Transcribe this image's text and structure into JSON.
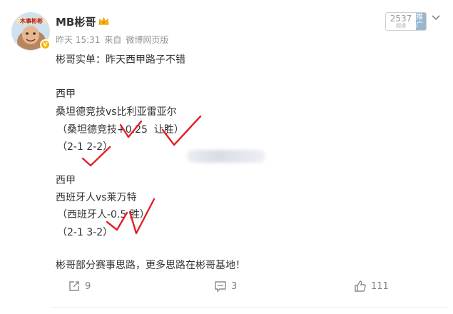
{
  "author": {
    "avatar_text": "木事彬彬",
    "name": "MB彬哥",
    "badge_icon": "crown-icon",
    "verified_icon": "verified-badge-icon"
  },
  "meta": {
    "time": "昨天 15:31",
    "source_prefix": "来自",
    "source": "微博网页版"
  },
  "promo": {
    "count": "2537",
    "count_label": "阅读",
    "boost_label": "推广"
  },
  "post": {
    "lines": [
      "彬哥实单：昨天西甲路子不错",
      "西甲",
      "桑坦德竞技vs比利亚雷亚尔",
      "（桑坦德竞技+0.25  让胜）",
      "（2-1 2-2）",
      "西甲",
      "西班牙人vs莱万特",
      "（西班牙人-0.5 胜）",
      "（2-1 3-2）",
      "彬哥部分赛事思路，更多思路在彬哥基地！"
    ]
  },
  "actions": {
    "repost_icon": "share-icon",
    "repost_count": "9",
    "comment_icon": "comment-icon",
    "comment_count": "3",
    "like_icon": "thumbs-up-icon",
    "like_count": "111"
  },
  "colors": {
    "check_marks": "#e0202a",
    "meta_text": "#939393",
    "promo_bg": "#9ab6ce"
  }
}
